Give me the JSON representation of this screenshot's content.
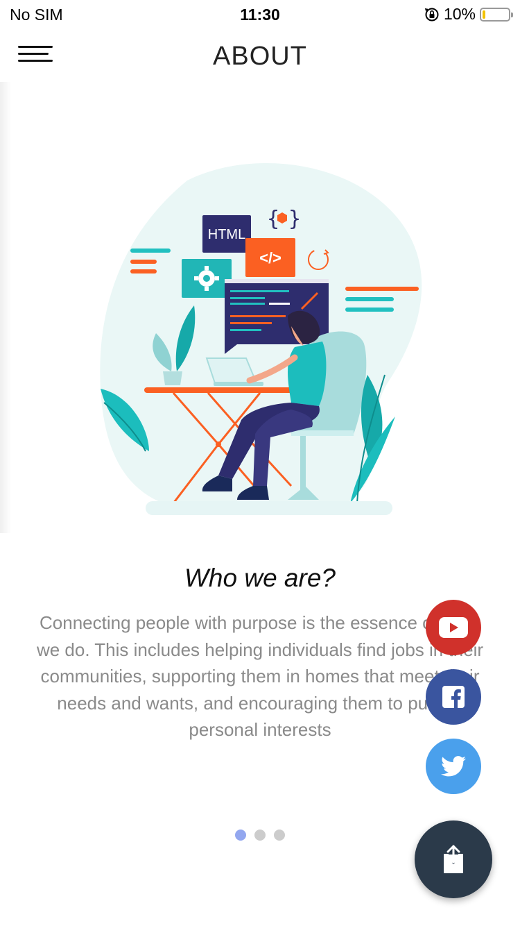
{
  "status_bar": {
    "carrier": "No SIM",
    "time": "11:30",
    "battery": "10%",
    "battery_level": 0.1,
    "battery_color": "#f2c300"
  },
  "header": {
    "title": "ABOUT",
    "menu_icon": "hamburger-menu-icon"
  },
  "illustration": {
    "html_label": "HTML",
    "code_label": "</>",
    "icons": [
      "gear-icon",
      "code-icon",
      "refresh-icon",
      "curly-braces-icon"
    ]
  },
  "content": {
    "heading": "Who we are?",
    "body": "Connecting people with purpose is the essence of what we do. This includes helping individuals find jobs in their communities, supporting them in homes that meet their needs and wants, and encouraging them to pursue personal interests"
  },
  "pagination": {
    "count": 3,
    "active_index": 0,
    "active_color": "#93a7ef"
  },
  "social": {
    "youtube": {
      "icon": "youtube-icon",
      "color": "#d0312b"
    },
    "facebook": {
      "icon": "facebook-icon",
      "color": "#3a559f"
    },
    "twitter": {
      "icon": "twitter-icon",
      "color": "#4aa0ec"
    },
    "share": {
      "icon": "share-icon",
      "color": "#2b3a4a"
    }
  }
}
